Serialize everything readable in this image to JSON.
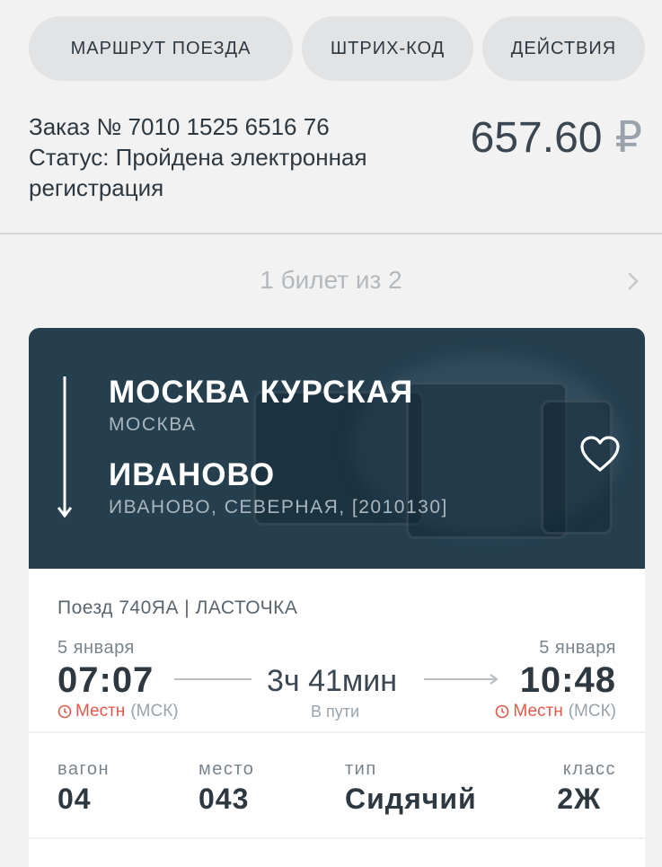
{
  "tabs": [
    "МАРШРУТ ПОЕЗДА",
    "ШТРИХ-КОД",
    "ДЕЙСТВИЯ"
  ],
  "order": {
    "number_line": "Заказ № 7010 1525 6516 76",
    "status_line": "Статус: Пройдена электронная регистрация",
    "price": "657.60",
    "currency": "₽"
  },
  "pager": {
    "text": "1 билет из 2"
  },
  "route": {
    "from_station": "МОСКВА КУРСКАЯ",
    "from_city": "МОСКВА",
    "to_station": "ИВАНОВО",
    "to_city": "ИВАНОВО, СЕВЕРНАЯ, [2010130]"
  },
  "trip": {
    "train": "Поезд 740ЯА | ЛАСТОЧКА",
    "dep_date": "5 января",
    "dep_time": "07:07",
    "arr_date": "5 января",
    "arr_time": "10:48",
    "local_label": "Местн",
    "tz_label": "(МСК)",
    "duration": "3ч 41мин",
    "in_transit": "В пути"
  },
  "seat": {
    "car_label": "вагон",
    "car_value": "04",
    "seat_label": "место",
    "seat_value": "043",
    "type_label": "тип",
    "type_value": "Сидячий",
    "class_label": "класс",
    "class_value": "2Ж"
  },
  "colors": {
    "accent_red": "#e05a4c",
    "hero_bg": "#253f4f",
    "text_dark": "#2e3841"
  }
}
